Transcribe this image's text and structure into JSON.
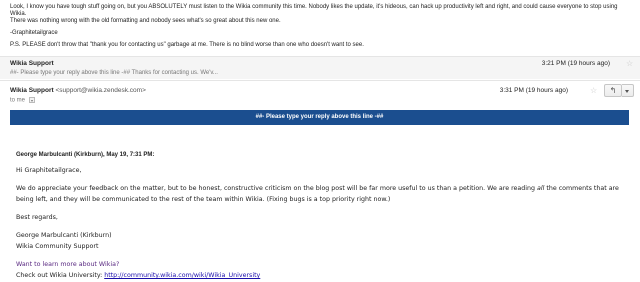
{
  "previous_message": {
    "line1": "Look, I know you have tough stuff going on, but you ABSOLUTELY must listen to the Wikia community this time. Nobody likes the update, it's hideous, can hack up productivity left and right, and could cause everyone to stop using Wikia.",
    "line2": "There was nothing wrong with the old formatting and nobody sees what's so great about this new one.",
    "signature": "-Graphitetailgrace",
    "ps": "P.S. PLEASE don't throw that \"thank you for contacting us\" garbage at me. There is no blind worse than one who doesn't want to see."
  },
  "collapsed_message": {
    "sender": "Wikia Support",
    "snippet": "##- Please type your reply above this line -## Thanks for contacting us. We'v...",
    "time": "3:21 PM (19 hours ago)"
  },
  "open_message": {
    "sender_name": "Wikia Support",
    "sender_email": "<support@wikia.zendesk.com>",
    "time": "3:31 PM (19 hours ago)",
    "to": "to me",
    "reply_icon": "reply-arrow-icon",
    "reply_banner": "##- Please type your reply above this line -##",
    "attribution": "George Marbulcanti (Kirkburn), May 19, 7:31 PM:",
    "greeting": "Hi Graphitetailgrace,",
    "body_line1_before": "We do appreciate your feedback on the matter, but to be honest, constructive criticism on the blog post will be far more useful to us than a petition. We are reading ",
    "body_line1_em": "all",
    "body_line1_after": " the comments that are",
    "body_line2": "being left, and they will be communicated to the rest of the team within Wikia. (Fixing bugs is a top priority right now.)",
    "closing": "Best regards,",
    "sig_name": "George Marbulcanti (Kirkburn)",
    "sig_title": "Wikia Community Support",
    "learn_more": "Want to learn more about Wikia?",
    "university_text": "Check out Wikia University: ",
    "university_link": "http://community.wikia.com/wiki/Wikia_University"
  },
  "colors": {
    "banner": "#1b4e8f",
    "link": "#1a0dab",
    "purple": "#5a2a82"
  }
}
